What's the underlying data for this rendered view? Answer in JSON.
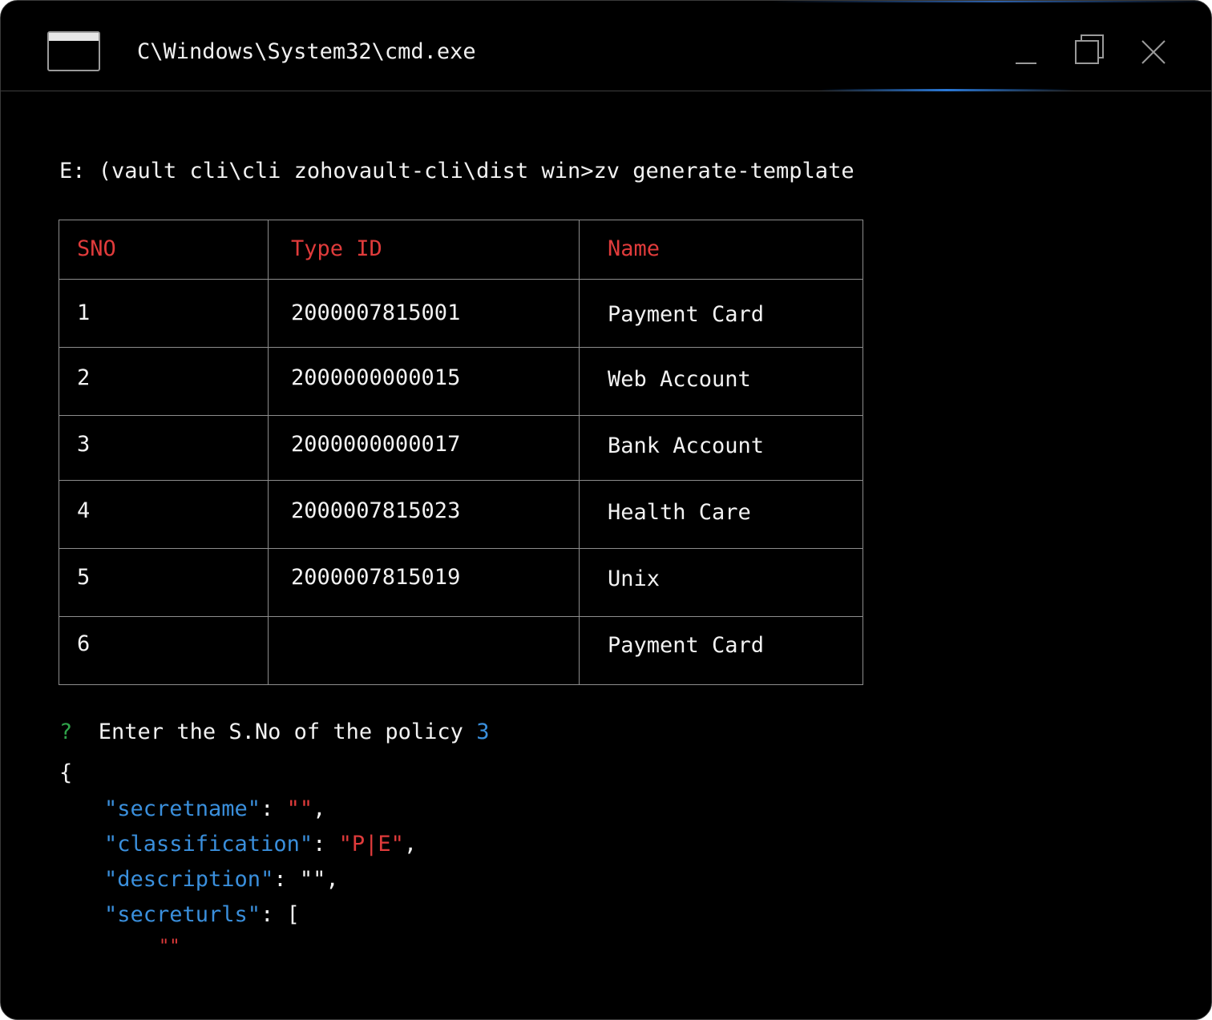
{
  "window": {
    "title": "C\\Windows\\System32\\cmd.exe"
  },
  "terminal": {
    "command_line": "E: (vault cli\\cli zohovault-cli\\dist win>zv generate-template",
    "table": {
      "headers": [
        "SNO",
        "Type ID",
        "Name"
      ],
      "rows": [
        {
          "sno": "1",
          "type_id": "2000007815001",
          "name": "Payment Card"
        },
        {
          "sno": "2",
          "type_id": "2000000000015",
          "name": "Web Account"
        },
        {
          "sno": "3",
          "type_id": "2000000000017",
          "name": "Bank Account"
        },
        {
          "sno": "4",
          "type_id": "2000007815023",
          "name": "Health Care"
        },
        {
          "sno": "5",
          "type_id": "2000007815019",
          "name": "Unix"
        },
        {
          "sno": "6",
          "type_id": "",
          "name": "Payment Card"
        }
      ]
    },
    "prompt": {
      "marker": "?",
      "text": "Enter the S.No of the policy",
      "answer": "3"
    },
    "json_output": {
      "open_brace": "{",
      "secretname_key": "\"secretname\"",
      "secretname_value": "\"\"",
      "classification_key": "\"classification\"",
      "classification_value": "\"P|E\"",
      "description_key": "\"description\"",
      "description_value": "\"\"",
      "secreturls_key": "\"secreturls\"",
      "secreturls_open": "[",
      "secreturls_item": "\"\""
    }
  },
  "colors": {
    "background": "#000000",
    "header_text": "#e03b3b",
    "prompt_marker": "#2fa34a",
    "json_key": "#3a8fdc",
    "json_string": "#e03b3b",
    "accent_glow": "#2a78d6"
  },
  "icons": {
    "app": "console-window-icon",
    "minimize": "minimize-icon",
    "maximize": "restore-icon",
    "close": "close-icon"
  }
}
